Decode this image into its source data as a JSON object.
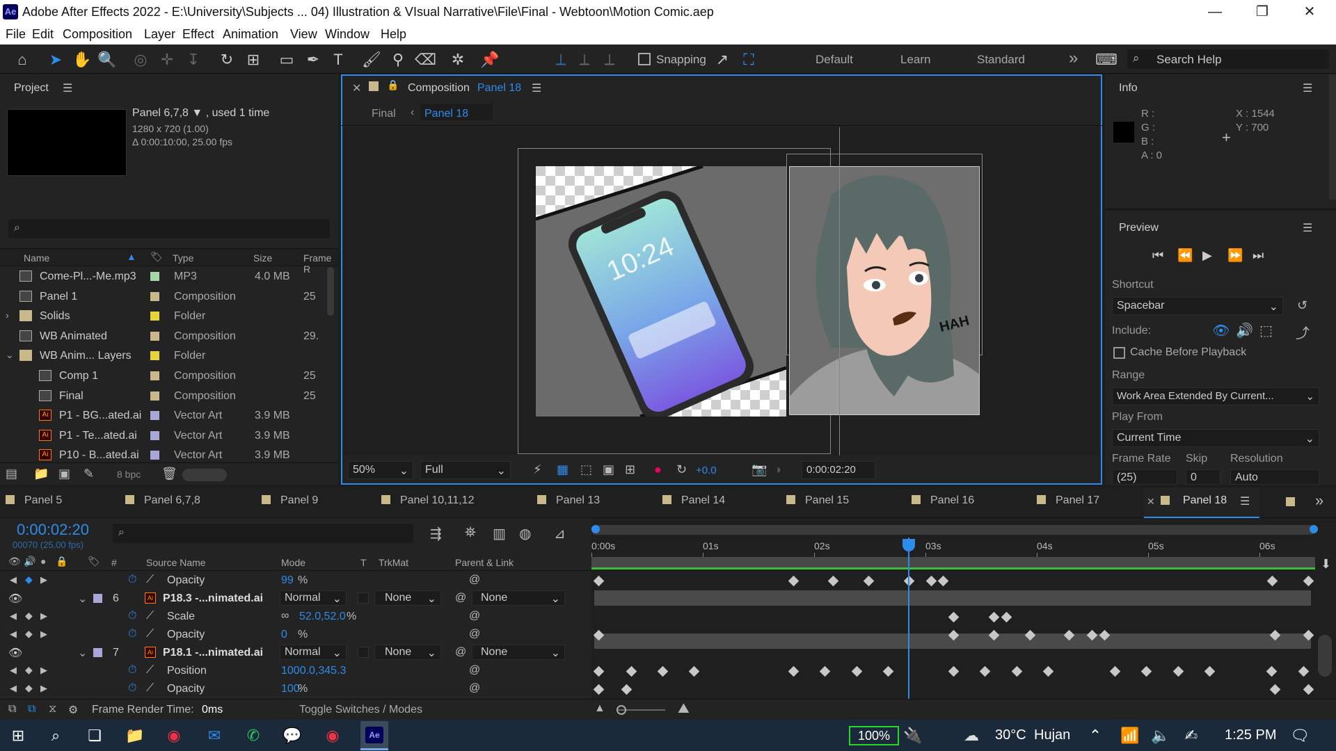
{
  "window": {
    "title": "Adobe After Effects 2022 - E:\\University\\Subjects ... 04) Illustration & VIsual Narrative\\File\\Final - Webtoon\\Motion Comic.aep",
    "app_icon": "Ae",
    "controls": [
      "—",
      "❐",
      "✕"
    ]
  },
  "menu": [
    "File",
    "Edit",
    "Composition",
    "Layer",
    "Effect",
    "Animation",
    "View",
    "Window",
    "Help"
  ],
  "toolbar": {
    "snapping_label": "Snapping",
    "workspaces": [
      "Default",
      "Learn",
      "Standard"
    ],
    "more": "»",
    "search_placeholder": "Search Help"
  },
  "project": {
    "title": "Project",
    "selected_name": "Panel 6,7,8",
    "selected_usage": ", used 1 time",
    "selected_res": "1280 x 720 (1.00)",
    "selected_duration": "Δ 0:00:10:00, 25.00 fps",
    "columns": {
      "name": "Name",
      "type": "Type",
      "size": "Size",
      "frame": "Frame R"
    },
    "items": [
      {
        "name": "Come-Pl...-Me.mp3",
        "type": "MP3",
        "size": "4.0 MB",
        "frame": "",
        "color": "#a8d8a8",
        "icon": "audio"
      },
      {
        "name": "Panel 1",
        "type": "Composition",
        "size": "",
        "frame": "25",
        "color": "#c9b98a",
        "icon": "comp"
      },
      {
        "name": "Solids",
        "type": "Folder",
        "size": "",
        "frame": "",
        "color": "#e8d33a",
        "icon": "folder"
      },
      {
        "name": "WB Animated",
        "type": "Composition",
        "size": "",
        "frame": "29.",
        "color": "#c9b98a",
        "icon": "comp"
      },
      {
        "name": "WB Anim... Layers",
        "type": "Folder",
        "size": "",
        "frame": "",
        "color": "#e8d33a",
        "icon": "folder"
      },
      {
        "name": "Comp 1",
        "type": "Composition",
        "size": "",
        "frame": "25",
        "color": "#c9b98a",
        "icon": "comp"
      },
      {
        "name": "Final",
        "type": "Composition",
        "size": "",
        "frame": "25",
        "color": "#c9b98a",
        "icon": "comp"
      },
      {
        "name": "P1 - BG...ated.ai",
        "type": "Vector Art",
        "size": "3.9 MB",
        "frame": "",
        "color": "#a8a8d8",
        "icon": "ai"
      },
      {
        "name": "P1 - Te...ated.ai",
        "type": "Vector Art",
        "size": "3.9 MB",
        "frame": "",
        "color": "#a8a8d8",
        "icon": "ai"
      },
      {
        "name": "P10 - B...ated.ai",
        "type": "Vector Art",
        "size": "3.9 MB",
        "frame": "",
        "color": "#a8a8d8",
        "icon": "ai"
      }
    ],
    "bpc": "8 bpc"
  },
  "composition": {
    "tab_prefix": "Composition",
    "tab_name": "Panel 18",
    "breadcrumbs": [
      "Final",
      "Panel 18"
    ],
    "zoom": "50%",
    "quality": "Full",
    "exposure": "+0.0",
    "timecode": "0:00:02:20",
    "phone_time": "10:24",
    "sfx": "HAH"
  },
  "info": {
    "title": "Info",
    "r": "R :",
    "g": "G :",
    "b": "B :",
    "a": "A :  0",
    "x": "X : 1544",
    "y": "Y : 700"
  },
  "preview": {
    "title": "Preview",
    "shortcut_label": "Shortcut",
    "shortcut_value": "Spacebar",
    "include_label": "Include:",
    "cache_label": "Cache Before Playback",
    "range_label": "Range",
    "range_value": "Work Area Extended By Current...",
    "playfrom_label": "Play From",
    "playfrom_value": "Current Time",
    "framerate_label": "Frame Rate",
    "framerate_value": "(25)",
    "skip_label": "Skip",
    "skip_value": "0",
    "resolution_label": "Resolution",
    "resolution_value": "Auto"
  },
  "timeline": {
    "tabs": [
      "Panel 5",
      "Panel 6,7,8",
      "Panel 9",
      "Panel 10,11,12",
      "Panel 13",
      "Panel 14",
      "Panel 15",
      "Panel 16",
      "Panel 17",
      "Panel 18"
    ],
    "current_time": "0:00:02:20",
    "frame_info": "00070 (25.00 fps)",
    "col_hash": "#",
    "col_source": "Source Name",
    "col_mode": "Mode",
    "col_t": "T",
    "col_trkmat": "TrkMat",
    "col_parent": "Parent & Link",
    "ruler": [
      "0:00s",
      "01s",
      "02s",
      "03s",
      "04s",
      "05s",
      "06s"
    ],
    "rows": [
      {
        "kind": "prop",
        "name": "Opacity",
        "value": "99",
        "unit": "%"
      },
      {
        "kind": "layer",
        "num": "6",
        "name": "P18.3 -...nimated.ai",
        "mode": "Normal",
        "trkmat": "None",
        "parent": "None"
      },
      {
        "kind": "prop",
        "name": "Scale",
        "value": "52.0,52.0",
        "unit": "%"
      },
      {
        "kind": "prop",
        "name": "Opacity",
        "value": "0",
        "unit": "%"
      },
      {
        "kind": "layer",
        "num": "7",
        "name": "P18.1 -...nimated.ai",
        "mode": "Normal",
        "trkmat": "None",
        "parent": "None"
      },
      {
        "kind": "prop",
        "name": "Position",
        "value": "1000.0,345.3",
        "unit": ""
      },
      {
        "kind": "prop",
        "name": "Opacity",
        "value": "100",
        "unit": "%"
      }
    ],
    "frame_render_label": "Frame Render Time:",
    "frame_render_value": "0ms",
    "toggle_label": "Toggle Switches / Modes"
  },
  "taskbar": {
    "battery": "100%",
    "weather_temp": "30°C",
    "weather_text": "Hujan",
    "time": "1:25 PM"
  }
}
